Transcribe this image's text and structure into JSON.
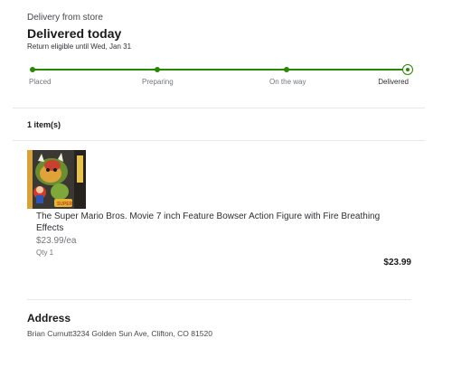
{
  "order": {
    "delivery_type": "Delivery from store",
    "status_title": "Delivered today",
    "return_note": "Return eligible until Wed, Jan 31"
  },
  "tracker": {
    "progress": 1.0,
    "accent_color": "#2a8703",
    "steps": [
      "Placed",
      "Preparing",
      "On the way",
      "Delivered"
    ],
    "current_step": "Delivered"
  },
  "items_section": {
    "count_label": "1 item(s)"
  },
  "item": {
    "image_icon": "bowser-action-figure-box",
    "name": "The Super Mario Bros. Movie 7 inch Feature Bowser Action Figure with Fire Breathing Effects",
    "unit_price": "$23.99/ea",
    "quantity": "Qty 1",
    "total": "$23.99"
  },
  "address": {
    "heading": "Address",
    "text": "Brian Curnutt3234 Golden Sun Ave, Clifton, CO 81520"
  }
}
